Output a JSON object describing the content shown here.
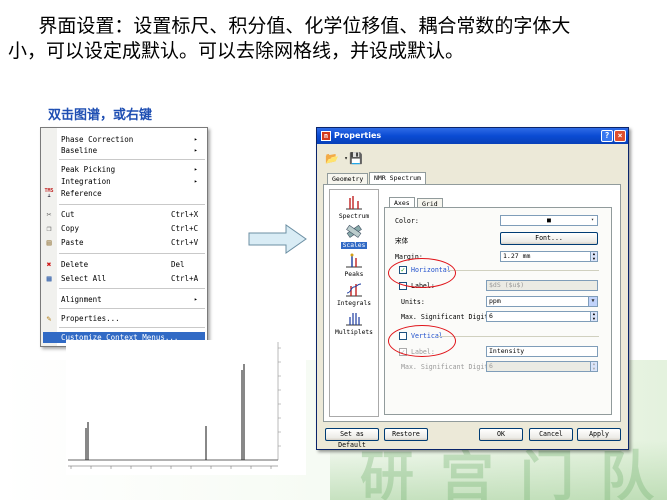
{
  "slide": {
    "title": "界面设置：设置标尺、积分值、化学位移值、耦合常数的字体大小，可以设定成默认。可以去除网格线，并设成默认。",
    "subtitle": "双击图谱，或右键"
  },
  "context_menu": {
    "items": [
      {
        "label": "Phase Correction",
        "submenu": true
      },
      {
        "label": "Baseline",
        "submenu": true
      },
      {
        "label": "Peak Picking",
        "submenu": true
      },
      {
        "label": "Integration",
        "submenu": true
      },
      {
        "label": "Reference",
        "icon": "tms-icon"
      },
      {
        "label": "Cut",
        "shortcut": "Ctrl+X",
        "icon": "scissors-icon"
      },
      {
        "label": "Copy",
        "shortcut": "Ctrl+C",
        "icon": "copy-icon"
      },
      {
        "label": "Paste",
        "shortcut": "Ctrl+V",
        "icon": "paste-icon"
      },
      {
        "label": "Delete",
        "shortcut": "Del",
        "icon": "delete-icon"
      },
      {
        "label": "Select All",
        "shortcut": "Ctrl+A",
        "icon": "select-all-icon"
      },
      {
        "label": "Alignment",
        "submenu": true
      },
      {
        "label": "Properties...",
        "icon": "properties-icon"
      },
      {
        "label": "Customize Context Menus..."
      }
    ]
  },
  "spectrum": {
    "icon_label": "spectrum-thumbnail"
  },
  "dialog": {
    "title": "Properties",
    "help_glyph": "?",
    "close_glyph": "×",
    "outer_tabs": [
      "Geometry",
      "NMR Spectrum"
    ],
    "sidebar": [
      "Spectrum",
      "Scales",
      "Peaks",
      "Integrals",
      "Multiplets"
    ],
    "inner_tabs": [
      "Axes",
      "Grid"
    ],
    "color_label": "Color:",
    "color_value": "■",
    "font_sample": "宋体",
    "font_button": "Font...",
    "margin_label": "Margin:",
    "margin_value": "1.27 mm",
    "horizontal": {
      "title": "Horizontal",
      "checked": true,
      "label_label": "Label:",
      "label_value": "$dS ($u$)",
      "units_label": "Units:",
      "units_value": "ppm",
      "digits_label": "Max. Significant Digits:",
      "digits_value": "6"
    },
    "vertical": {
      "title": "Vertical",
      "checked": false,
      "label_label": "Label:",
      "label_value": "Intensity",
      "digits_label": "Max. Significant Digits:",
      "digits_value": "6"
    },
    "buttons": {
      "set_default": "Set as Default",
      "restore": "Restore",
      "ok": "OK",
      "cancel": "Cancel",
      "apply": "Apply"
    }
  },
  "colors": {
    "accent_red": "#e0141a",
    "title_blue": "#1f4fb3",
    "arrow_fill": "#d9ecf5"
  }
}
